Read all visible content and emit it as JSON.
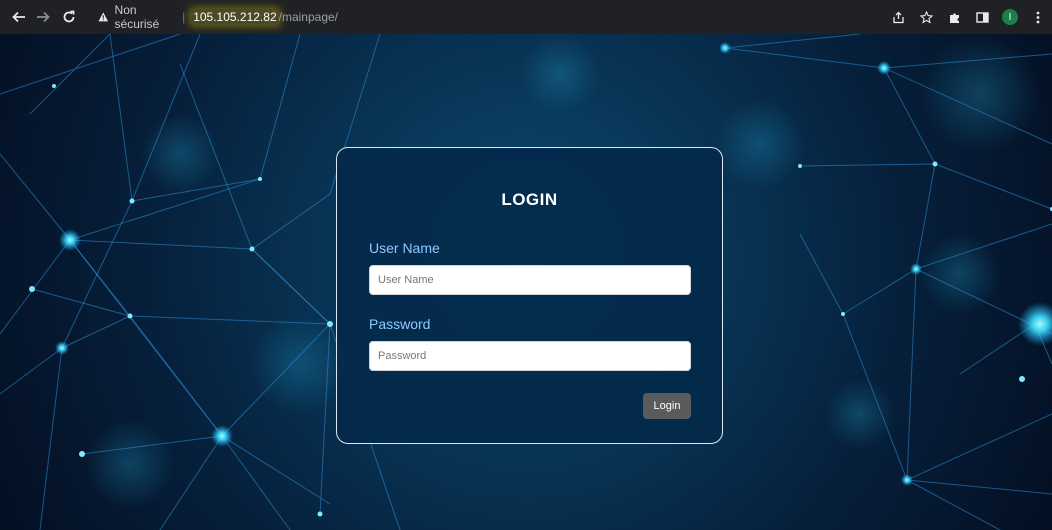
{
  "browser": {
    "security_label": "Non sécurisé",
    "separator": "|",
    "url_host": "105.105.212.82",
    "url_path": "/mainpage/",
    "icons": {
      "back": "arrow-left-icon",
      "forward": "arrow-right-icon",
      "reload": "reload-icon",
      "warning": "warning-triangle-icon",
      "share": "share-icon",
      "bookmark": "star-icon",
      "extensions": "puzzle-icon",
      "sidepanel": "side-panel-icon",
      "menu": "kebab-menu-icon"
    },
    "profile_initial": "I",
    "colors": {
      "toolbar": "#202124",
      "profile": "#1b7f47",
      "url_highlight": "#fff12a"
    }
  },
  "login": {
    "title": "LOGIN",
    "username_label": "User Name",
    "username_placeholder": "User Name",
    "username_value": "",
    "password_label": "Password",
    "password_placeholder": "Password",
    "password_value": "",
    "submit_label": "Login",
    "colors": {
      "label": "#8ec9ff",
      "button": "#5a5b5d",
      "card_bg": "#03294a"
    }
  }
}
